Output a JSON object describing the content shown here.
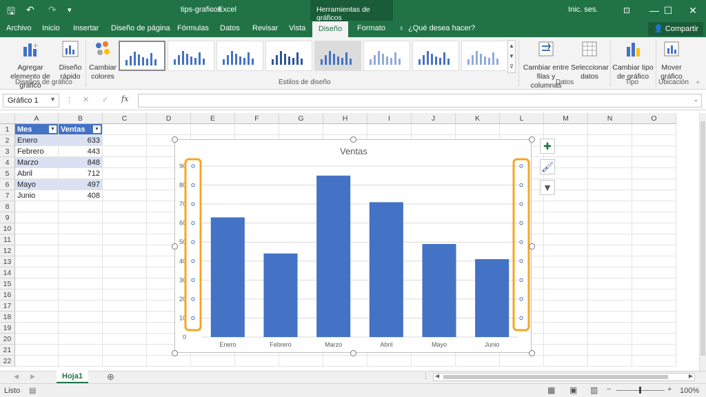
{
  "window": {
    "doc_name": "tips-graficos",
    "app_name": "Excel",
    "context_tab_label": "Herramientas de gráficos",
    "sign_in": "Inic. ses."
  },
  "tabs": [
    "Archivo",
    "Inicio",
    "Insertar",
    "Diseño de página",
    "Fórmulas",
    "Datos",
    "Revisar",
    "Vista",
    "Diseño",
    "Formato"
  ],
  "tell_me": "¿Qué desea hacer?",
  "share_label": "Compartir",
  "ribbon": {
    "add_element": "Agregar elemento de gráfico",
    "quick_layout": "Diseño rápido",
    "change_colors": "Cambiar colores",
    "group_layouts": "Diseños de gráfico",
    "group_styles": "Estilos de diseño",
    "switch_rowcol": "Cambiar entre filas y columnas",
    "select_data": "Seleccionar datos",
    "group_data": "Datos",
    "change_type": "Cambiar tipo de gráfico",
    "group_type": "Tipo",
    "move_chart": "Mover gráfico",
    "group_location": "Ubicación"
  },
  "formula_bar": {
    "name_box": "Gráfico 1",
    "fx": "fx",
    "cancel": "✕",
    "enter": "✓"
  },
  "columns": [
    "A",
    "B",
    "C",
    "D",
    "E",
    "F",
    "G",
    "H",
    "I",
    "J",
    "K",
    "L",
    "M",
    "N",
    "O"
  ],
  "rows": [
    "1",
    "2",
    "3",
    "4",
    "5",
    "6",
    "7",
    "8",
    "9",
    "10",
    "11",
    "12",
    "13",
    "14",
    "15",
    "16",
    "17",
    "18",
    "19",
    "20",
    "21",
    "22"
  ],
  "table": {
    "headers": [
      "Mes",
      "Ventas"
    ],
    "rows": [
      [
        "Enero",
        "633"
      ],
      [
        "Febrero",
        "443"
      ],
      [
        "Marzo",
        "848"
      ],
      [
        "Abril",
        "712"
      ],
      [
        "Mayo",
        "497"
      ],
      [
        "Junio",
        "408"
      ]
    ]
  },
  "chart_data": {
    "type": "bar",
    "title": "Ventas",
    "categories": [
      "Enero",
      "Febrero",
      "Marzo",
      "Abril",
      "Mayo",
      "Junio"
    ],
    "values": [
      63,
      44,
      85,
      71,
      49,
      41
    ],
    "ylim": [
      0,
      90
    ],
    "yticks": [
      "0",
      "10",
      "20",
      "30",
      "40",
      "50",
      "60",
      "70",
      "80",
      "90"
    ],
    "grid": true,
    "bar_color": "#4472c4",
    "highlight_color": "#f5a623"
  },
  "sheet": {
    "tab": "Hoja1"
  },
  "status": {
    "ready": "Listo",
    "zoom": "100%"
  }
}
